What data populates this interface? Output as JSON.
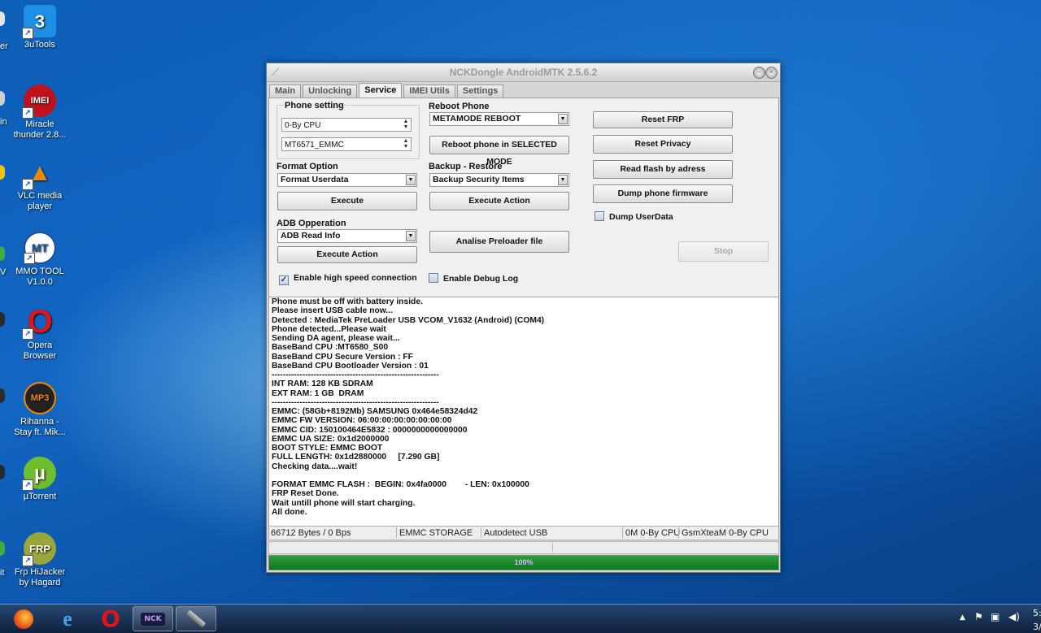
{
  "desktop": {
    "icons": [
      {
        "label": "3uTools",
        "glyph": "3"
      },
      {
        "label": "Miracle thunder 2.8...",
        "glyph": "IMEI"
      },
      {
        "label": "VLC media player",
        "glyph": "▲"
      },
      {
        "label": "MMO TOOL V1.0.0",
        "glyph": "MT"
      },
      {
        "label": "Opera Browser",
        "glyph": "O"
      },
      {
        "label": "Rihanna - Stay ft. Mik...",
        "glyph": "MP3"
      },
      {
        "label": "µTorrent",
        "glyph": "µ"
      },
      {
        "label": "Frp HiJacker by Hagard",
        "glyph": "FRP"
      }
    ],
    "edge_labels": [
      "er",
      "in",
      "V",
      "it"
    ]
  },
  "window": {
    "title": "NCKDongle AndroidMTK 2.5.6.2",
    "tabs": [
      "Main",
      "Unlocking",
      "Service",
      "IMEI Utils",
      "Settings"
    ],
    "phone_setting": {
      "label": "Phone setting",
      "cpu_brand": "0-By CPU",
      "cpu_model": "MT6571_EMMC"
    },
    "reboot": {
      "label": "Reboot Phone",
      "mode": "METAMODE REBOOT",
      "button": "Reboot phone in SELECTED MODE"
    },
    "format": {
      "label": "Format Option",
      "selected": "Format Userdata",
      "button": "Execute"
    },
    "backup": {
      "label": "Backup - Restore",
      "selected": "Backup Security Items",
      "button": "Execute Action"
    },
    "adb": {
      "label": "ADB Opperation",
      "selected": "ADB Read Info",
      "button": "Execute Action"
    },
    "analise_button": "Analise Preloader file",
    "right_buttons": {
      "reset_frp": "Reset FRP",
      "reset_privacy": "Reset Privacy",
      "read_flash": "Read flash by adress",
      "dump_firmware": "Dump phone firmware"
    },
    "dump_userdata": {
      "label": "Dump UserData",
      "checked": false
    },
    "stop_button": "Stop",
    "high_speed": {
      "label": "Enable high speed connection",
      "checked": true
    },
    "debug_log": {
      "label": "Enable Debug Log",
      "checked": false
    },
    "log": [
      "Phone must be off with battery inside.",
      "Please insert USB cable now...",
      "Detected : MediaTek PreLoader USB VCOM_V1632 (Android) (COM4)",
      "Phone detected...Please wait",
      "Sending DA agent, please wait...",
      "BaseBand CPU :MT6580_S00",
      "BaseBand CPU Secure Version : FF",
      "BaseBand CPU Bootloader Version : 01",
      "------------------------------------------------------------",
      "INT RAM: 128 KB SDRAM",
      "EXT RAM: 1 GB  DRAM",
      "------------------------------------------------------------",
      "EMMC: (58Gb+8192Mb) SAMSUNG 0x464e58324d42",
      "EMMC FW VERSION: 06:00:00:00:00:00:00:00",
      "EMMC CID: 150100464E5832 : 0000000000000000",
      "EMMC UA SIZE: 0x1d2000000",
      "BOOT STYLE: EMMC BOOT",
      "FULL LENGTH: 0x1d2880000     [7.290 GB]",
      "Checking data....wait!",
      "",
      "FORMAT EMMC FLASH :  BEGIN: 0x4fa0000        - LEN: 0x100000",
      "FRP Reset Done.",
      "Wait untill phone will start charging.",
      "All done."
    ],
    "status": {
      "bytes": "66712 Bytes / 0 Bps",
      "storage": "EMMC STORAGE",
      "usb": "Autodetect USB",
      "cpu": "0M 0-By CPU",
      "team": "GsmXteaM 0-By CPU"
    },
    "progress": {
      "value": 1.0,
      "text": "100%"
    }
  },
  "taskbar": {
    "apps": [
      {
        "name": "firefox",
        "glyph": "●"
      },
      {
        "name": "internet-explorer",
        "glyph": "e"
      },
      {
        "name": "opera",
        "glyph": "O"
      },
      {
        "name": "nck-dongle",
        "glyph": "NCK"
      },
      {
        "name": "tool",
        "glyph": "/"
      }
    ],
    "clock_time": "5:",
    "clock_date": "3/"
  },
  "colors": {
    "progress_green": "#0b7a1c",
    "desktop_blue": "#1266c2"
  }
}
